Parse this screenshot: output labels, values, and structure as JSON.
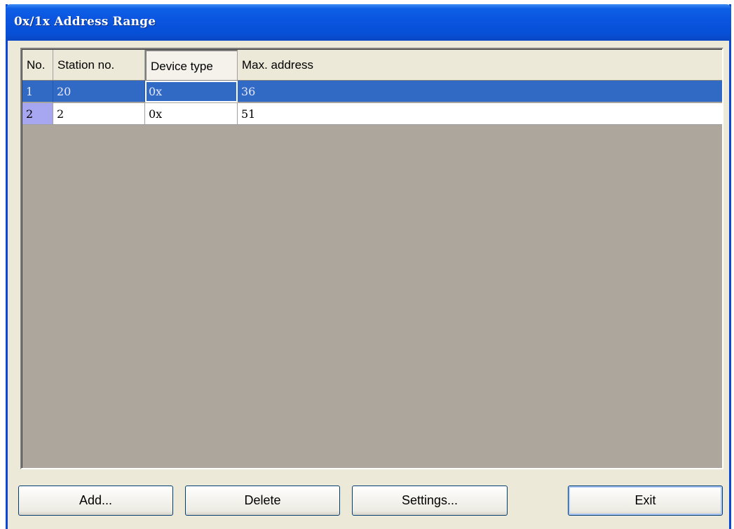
{
  "window": {
    "title": "0x/1x Address Range"
  },
  "grid": {
    "columns": [
      "No.",
      "Station no.",
      "Device type",
      "Max. address"
    ],
    "rows": [
      {
        "no": "1",
        "station": "20",
        "device": "0x",
        "max": "36",
        "selected": true
      },
      {
        "no": "2",
        "station": "2",
        "device": "0x",
        "max": "51",
        "selected": false
      }
    ]
  },
  "buttons": {
    "add": "Add...",
    "delete": "Delete",
    "settings": "Settings...",
    "exit": "Exit"
  },
  "colors": {
    "selection": "#316ac5",
    "titlebar": "#0a54df",
    "grid_background": "#aca69c",
    "row_header_highlight": "#a7a6f0"
  }
}
